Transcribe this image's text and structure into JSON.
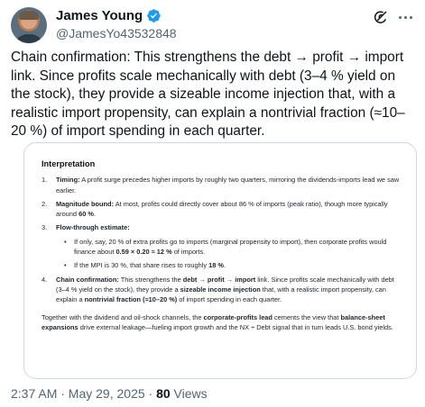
{
  "author": {
    "display_name": "James Young",
    "handle": "@JamesYo43532848"
  },
  "tweet": {
    "text": "Chain confirmation: This strengthens the debt → profit → import link. Since profits scale mechanically with debt (3–4 % yield on the stock), they provide a sizeable income injection that, with a realistic import propensity, can explain a nontrivial fraction (≈10–20 %) of import spending in each quarter."
  },
  "card": {
    "title": "Interpretation",
    "items": [
      {
        "num": "1.",
        "label": "Timing:",
        "text": " A profit surge precedes higher imports by roughly two quarters, mirroring the dividends-imports lead we saw earlier."
      },
      {
        "num": "2.",
        "label": "Magnitude bound:",
        "text": " At most, profits could directly cover about 86 % of imports (peak ratio), though more typically around ",
        "bold_tail": "60 %",
        "end": "."
      },
      {
        "num": "3.",
        "label": "Flow-through estimate:",
        "bullets": [
          {
            "pre": "If only, say, 20 % of extra profits go to imports (marginal propensity to import), then corporate profits would finance about ",
            "bold": "0.59 × 0.20 ≈ 12 %",
            "post": " of imports."
          },
          {
            "pre": "If the MPI is 30 %, that share rises to roughly ",
            "bold": "18 %",
            "post": "."
          }
        ]
      },
      {
        "num": "4.",
        "label": "Chain confirmation:",
        "text_a": " This strengthens the ",
        "bold_a": "debt → profit → import",
        "text_b": " link. Since profits scale mechanically with debt (3–4 % yield on the stock), they provide a ",
        "bold_b": "sizeable income injection",
        "text_c": " that, with a realistic import propensity, can explain a ",
        "bold_c": "nontrivial fraction (≈10–20 %)",
        "text_d": " of import spending in each quarter."
      }
    ],
    "closing": {
      "a": "Together with the dividend and oil-shock channels, the ",
      "b": "corporate-profits lead",
      "c": " cements the view that ",
      "d": "balance-sheet expansions",
      "e": " drive external leakage—fueling import growth and the NX ÷ Debt signal that in turn leads U.S. bond yields."
    }
  },
  "meta": {
    "time": "2:37 AM · May 29, 2025 · ",
    "views_count": "80",
    "views_label": " Views"
  },
  "icons": {
    "verified": "verified-badge-icon",
    "grok": "grok-icon",
    "more": "more-options-icon"
  },
  "colors": {
    "verified": "#1d9bf0",
    "secondary_text": "#536471",
    "primary_text": "#0f1419",
    "card_border": "#cfd9de"
  }
}
